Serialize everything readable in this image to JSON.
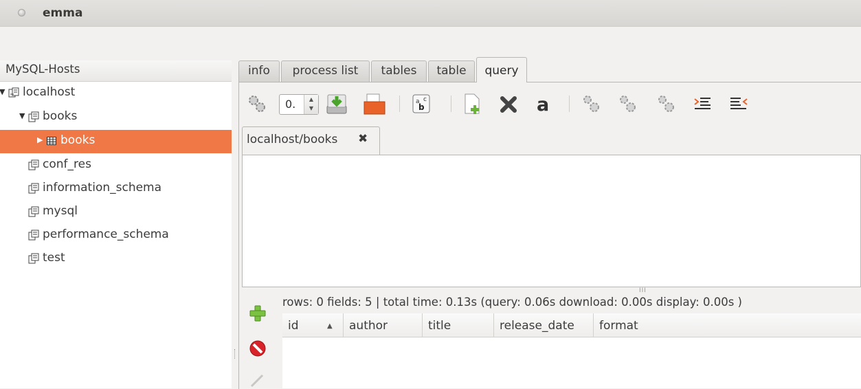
{
  "window": {
    "title": "emma"
  },
  "tree": {
    "header": "MySQL-Hosts",
    "items": [
      {
        "label": "localhost",
        "level": 0,
        "expanded": true,
        "selected": false
      },
      {
        "label": "books",
        "level": 1,
        "expanded": true,
        "selected": false
      },
      {
        "label": "books",
        "level": 2,
        "expanded": false,
        "selected": true
      },
      {
        "label": "conf_res",
        "level": 1,
        "selected": false
      },
      {
        "label": "information_schema",
        "level": 1,
        "selected": false
      },
      {
        "label": "mysql",
        "level": 1,
        "selected": false
      },
      {
        "label": "performance_schema",
        "level": 1,
        "selected": false
      },
      {
        "label": "test",
        "level": 1,
        "selected": false
      }
    ]
  },
  "tabs": [
    {
      "label": "info",
      "active": false
    },
    {
      "label": "process list",
      "active": false
    },
    {
      "label": "tables",
      "active": false
    },
    {
      "label": "table",
      "active": false
    },
    {
      "label": "query",
      "active": true
    }
  ],
  "toolbar": {
    "spin_value": "0.",
    "icons": [
      "execute-icon",
      "download-icon",
      "open-folder-icon",
      "abc-format-icon",
      "new-query-icon",
      "close-query-icon",
      "a-icon",
      "execute-all-icon",
      "execute-current-icon",
      "execute-selection-icon",
      "indent-icon",
      "outdent-icon"
    ]
  },
  "query_tab": {
    "label": "localhost/books",
    "close": "✖"
  },
  "status": "rows: 0 fields: 5 | total time: 0.13s (query: 0.06s download: 0.00s display: 0.00s )",
  "results": {
    "columns": [
      "id",
      "author",
      "title",
      "release_date",
      "format"
    ]
  },
  "colors": {
    "selection": "#f07746",
    "background": "#f2f1f0"
  }
}
